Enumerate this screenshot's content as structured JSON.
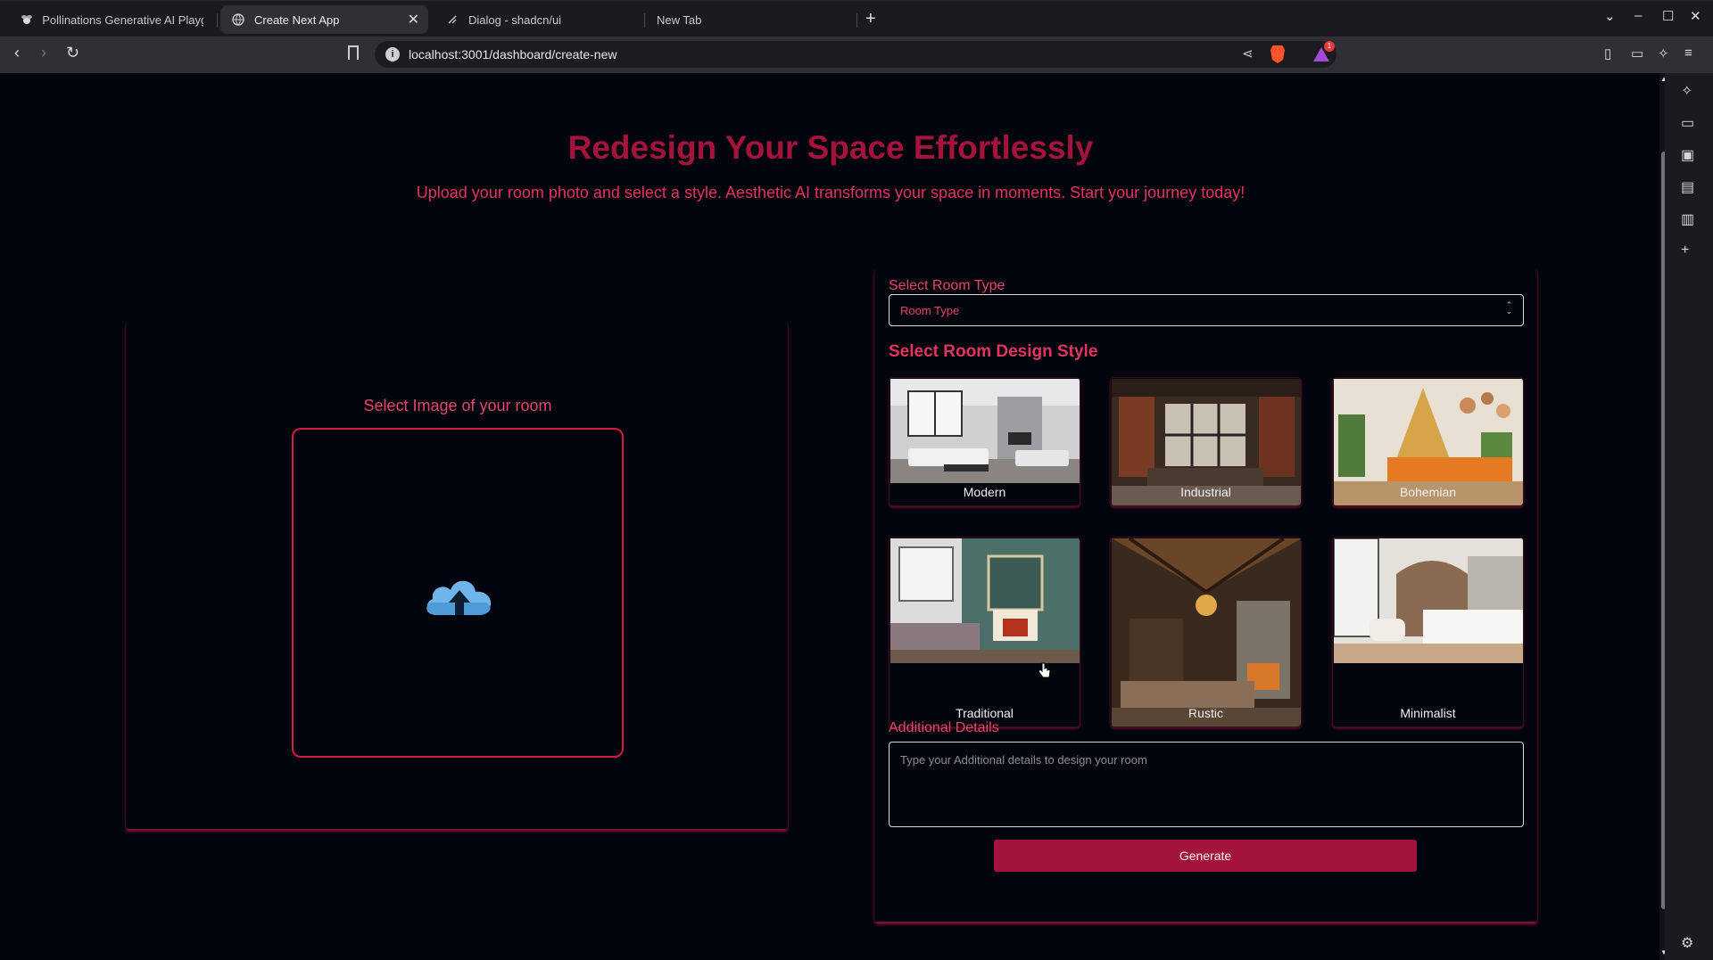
{
  "browser": {
    "tabs": [
      {
        "label": "Pollinations Generative AI Playgr",
        "icon": "bee-icon",
        "active": false
      },
      {
        "label": "Create Next App",
        "icon": "globe-icon",
        "active": true
      },
      {
        "label": "Dialog - shadcn/ui",
        "icon": "shadcn-icon",
        "active": false
      },
      {
        "label": "New Tab",
        "icon": "",
        "active": false
      }
    ],
    "url": "localhost:3001/dashboard/create-new",
    "rewards_badge": "1"
  },
  "page": {
    "title": "Redesign Your Space Effortlessly",
    "subtitle": "Upload your room photo and select a style. Aesthetic AI transforms your space in moments. Start your journey today!",
    "upload": {
      "label": "Select Image of your room",
      "icon": "cloud-upload-icon"
    },
    "room_type": {
      "label": "Select Room Type",
      "placeholder": "Room Type"
    },
    "design_style": {
      "heading": "Select Room Design Style",
      "styles": [
        {
          "name": "Modern"
        },
        {
          "name": "Industrial"
        },
        {
          "name": "Bohemian"
        },
        {
          "name": "Traditional"
        },
        {
          "name": "Rustic"
        },
        {
          "name": "Minimalist"
        }
      ]
    },
    "additional": {
      "label": "Additional Details",
      "placeholder": "Type your Additional details to design your room"
    },
    "generate_label": "Generate"
  },
  "colors": {
    "accent": "#a4133c",
    "accent_light": "#e2345f",
    "background": "#02040e"
  }
}
